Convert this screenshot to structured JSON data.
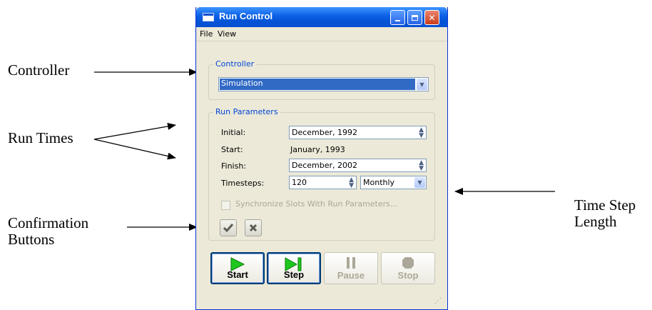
{
  "callouts": {
    "controller": "Controller",
    "run_times": "Run Times",
    "confirmation_line1": "Confirmation",
    "confirmation_line2": "Buttons",
    "time_step_line1": "Time Step",
    "time_step_line2": "Length"
  },
  "window": {
    "title": "Run Control",
    "menu": [
      "File",
      "View"
    ],
    "controller_group": {
      "title": "Controller",
      "selected": "Simulation"
    },
    "run_parameters": {
      "title": "Run Parameters",
      "initial_label": "Initial:",
      "initial_value": "December, 1992",
      "start_label": "Start:",
      "start_value": "January, 1993",
      "finish_label": "Finish:",
      "finish_value": "December, 2002",
      "timesteps_label": "Timesteps:",
      "timesteps_value": "120",
      "timestep_unit": "Monthly",
      "sync_label": "Synchronize Slots With Run Parameters..."
    },
    "buttons": {
      "start": "Start",
      "step": "Step",
      "pause": "Pause",
      "stop": "Stop"
    }
  },
  "colors": {
    "title_bar": "#0a5fe6",
    "group_title": "#0046d5",
    "selection": "#316ac5",
    "play_green": "#1ec81e",
    "disabled_gray": "#aca899"
  }
}
